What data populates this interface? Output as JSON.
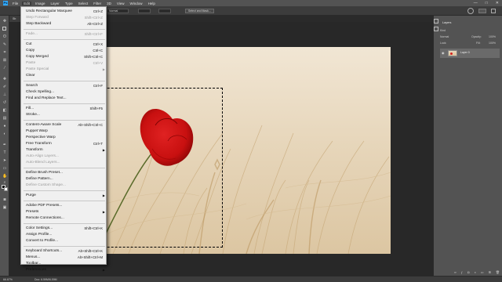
{
  "menubar": {
    "logo": "Ps",
    "items": [
      "File",
      "Edit",
      "Image",
      "Layer",
      "Type",
      "Select",
      "Filter",
      "3D",
      "View",
      "Window",
      "Help"
    ],
    "window_min": "—",
    "window_max": "□",
    "window_close": "✕"
  },
  "options": {
    "style": "Normal",
    "refine": "Select and Mask..."
  },
  "tab": {
    "title": "Sb"
  },
  "edit_menu": {
    "items": [
      {
        "label": "Undo Rectangular Marquee",
        "shortcut": "Ctrl+Z",
        "disabled": false
      },
      {
        "label": "Step Forward",
        "shortcut": "Shift+Ctrl+Z",
        "disabled": true
      },
      {
        "label": "Step Backward",
        "shortcut": "Alt+Ctrl+Z",
        "disabled": false
      },
      {
        "label": "Fade...",
        "shortcut": "Shift+Ctrl+F",
        "disabled": true
      },
      {
        "label": "Cut",
        "shortcut": "Ctrl+X",
        "disabled": false
      },
      {
        "label": "Copy",
        "shortcut": "Ctrl+C",
        "disabled": false
      },
      {
        "label": "Copy Merged",
        "shortcut": "Shift+Ctrl+C",
        "disabled": false
      },
      {
        "label": "Paste",
        "shortcut": "Ctrl+V",
        "disabled": true
      },
      {
        "label": "Paste Special",
        "shortcut": "",
        "disabled": true,
        "submenu": true
      },
      {
        "label": "Clear",
        "shortcut": "",
        "disabled": false
      },
      {
        "label": "Search",
        "shortcut": "Ctrl+F",
        "disabled": false
      },
      {
        "label": "Check Spelling...",
        "shortcut": "",
        "disabled": false
      },
      {
        "label": "Find and Replace Text...",
        "shortcut": "",
        "disabled": false
      },
      {
        "label": "Fill...",
        "shortcut": "Shift+F5",
        "disabled": false
      },
      {
        "label": "Stroke...",
        "shortcut": "",
        "disabled": false
      },
      {
        "label": "Content-Aware Scale",
        "shortcut": "Alt+Shift+Ctrl+C",
        "disabled": false
      },
      {
        "label": "Puppet Warp",
        "shortcut": "",
        "disabled": false
      },
      {
        "label": "Perspective Warp",
        "shortcut": "",
        "disabled": false
      },
      {
        "label": "Free Transform",
        "shortcut": "Ctrl+T",
        "disabled": false
      },
      {
        "label": "Transform",
        "shortcut": "",
        "disabled": false,
        "submenu": true
      },
      {
        "label": "Auto-Align Layers...",
        "shortcut": "",
        "disabled": true
      },
      {
        "label": "Auto-Blend Layers...",
        "shortcut": "",
        "disabled": true
      },
      {
        "label": "Define Brush Preset...",
        "shortcut": "",
        "disabled": false
      },
      {
        "label": "Define Pattern...",
        "shortcut": "",
        "disabled": false
      },
      {
        "label": "Define Custom Shape...",
        "shortcut": "",
        "disabled": true
      },
      {
        "label": "Purge",
        "shortcut": "",
        "disabled": false,
        "submenu": true
      },
      {
        "label": "Adobe PDF Presets...",
        "shortcut": "",
        "disabled": false
      },
      {
        "label": "Presets",
        "shortcut": "",
        "disabled": false,
        "submenu": true
      },
      {
        "label": "Remote Connections...",
        "shortcut": "",
        "disabled": false
      },
      {
        "label": "Color Settings...",
        "shortcut": "Shift+Ctrl+K",
        "disabled": false
      },
      {
        "label": "Assign Profile...",
        "shortcut": "",
        "disabled": false
      },
      {
        "label": "Convert to Profile...",
        "shortcut": "",
        "disabled": false
      },
      {
        "label": "Keyboard Shortcuts...",
        "shortcut": "Alt+Shift+Ctrl+K",
        "disabled": false
      },
      {
        "label": "Menus...",
        "shortcut": "Alt+Shift+Ctrl+M",
        "disabled": false
      },
      {
        "label": "Toolbar...",
        "shortcut": "",
        "disabled": false
      },
      {
        "label": "Preferences",
        "shortcut": "",
        "disabled": false,
        "submenu": true
      }
    ]
  },
  "panels": {
    "tab": "Layers",
    "kind": "Kind",
    "blend": "Normal",
    "opacity_label": "Opacity:",
    "opacity": "100%",
    "lock_label": "Lock:",
    "fill_label": "Fill:",
    "fill": "100%",
    "layer_name": "Layer 0"
  },
  "status": {
    "zoom": "66.67%",
    "doc": "Doc: 6.59M/6.59M"
  },
  "colors": {
    "accent": "#31a8ff",
    "poppy": "#d01818",
    "menu_bg": "#f0f0f0"
  }
}
